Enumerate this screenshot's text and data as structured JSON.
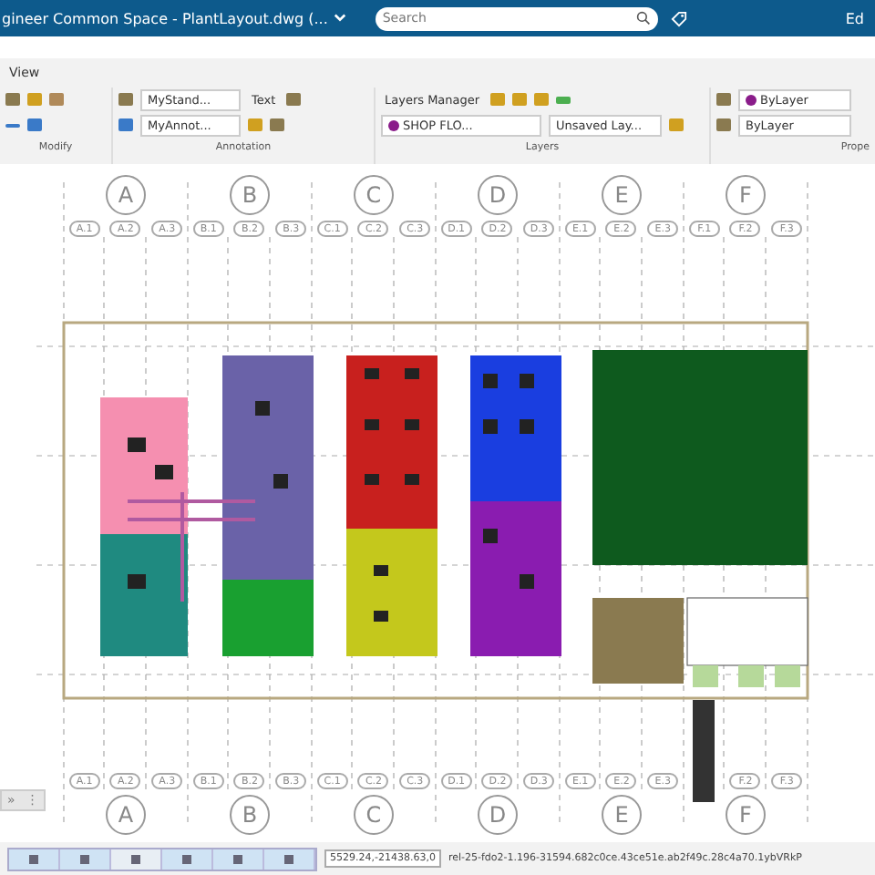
{
  "title_bar": {
    "title": "gineer Common Space - PlantLayout.dwg (...",
    "search": {
      "placeholder": "Search"
    },
    "user": "Ed"
  },
  "ribbon": {
    "tabs": [
      {
        "label": "View"
      }
    ],
    "panels": [
      {
        "label": "Modify"
      },
      {
        "label": "Annotation"
      },
      {
        "label": "Layers"
      },
      {
        "label": "Prope"
      }
    ],
    "text_style": "MyStand...",
    "text_button": "Text",
    "dim_style": "MyAnnot...",
    "layers_manager": "Layers Manager",
    "current_layer": "SHOP FLO...",
    "layer_state": "Unsaved Lay...",
    "color_setting": "ByLayer",
    "linetype": "ByLayer"
  },
  "grid_top": [
    {
      "label": "A",
      "subs": [
        "A.1",
        "A.2",
        "A.3"
      ]
    },
    {
      "label": "B",
      "subs": [
        "B.1",
        "B.2",
        "B.3"
      ]
    },
    {
      "label": "C",
      "subs": [
        "C.1",
        "C.2",
        "C.3"
      ]
    },
    {
      "label": "D",
      "subs": [
        "D.1",
        "D.2",
        "D.3"
      ]
    },
    {
      "label": "E",
      "subs": [
        "E.1",
        "E.2",
        "E.3"
      ]
    },
    {
      "label": "F",
      "subs": [
        "F.1",
        "F.2",
        "F.3"
      ]
    }
  ],
  "grid_bottom": [
    {
      "label": "A",
      "subs": [
        "A.1",
        "A.2",
        "A.3"
      ]
    },
    {
      "label": "B",
      "subs": [
        "B.1",
        "B.2",
        "B.3"
      ]
    },
    {
      "label": "C",
      "subs": [
        "C.1",
        "C.2",
        "C.3"
      ]
    },
    {
      "label": "D",
      "subs": [
        "D.1",
        "D.2",
        "D.3"
      ]
    },
    {
      "label": "E",
      "subs": [
        "E.1",
        "E.2",
        "E.3"
      ]
    },
    {
      "label": "F",
      "subs": [
        "F.2",
        "F.3"
      ]
    }
  ],
  "side_tools": [
    "»",
    "⋮"
  ],
  "status_bar": {
    "toggles": [
      {
        "on": true
      },
      {
        "on": true
      },
      {
        "on": false
      },
      {
        "on": true
      },
      {
        "on": true
      },
      {
        "on": true
      }
    ],
    "coordinates": "5529.24,-21438.63,0",
    "build": "rel-25-fdo2-1.196-31594.682c0ce.43ce51e.ab2f49c.28c4a70.1ybVRkP"
  }
}
